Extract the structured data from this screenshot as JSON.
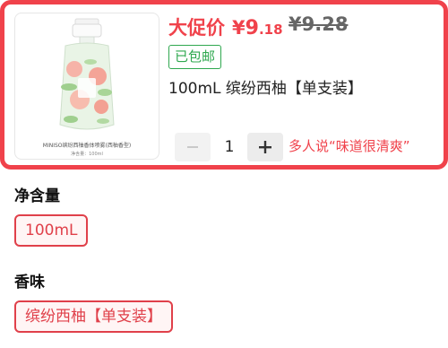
{
  "product": {
    "price_tag": "大促价",
    "currency": "¥",
    "price_int": "9",
    "price_dec": ".18",
    "original_price": "¥9.28",
    "shipping_badge": "已包邮",
    "variant": "100mL 缤纷西柚【单支装】",
    "image_caption": "MINISO缤纷西柚香体喷雾(西柚香型)",
    "image_net_content": "净含量：100ml"
  },
  "quantity": {
    "value": "1",
    "minus_icon": "minus-icon",
    "plus_icon": "plus-icon"
  },
  "promo_text": "多人说“味道很清爽”",
  "options": {
    "volume": {
      "title": "净含量",
      "selected": "100mL"
    },
    "scent": {
      "title": "香味",
      "selected": "缤纷西柚【单支装】"
    }
  },
  "colors": {
    "accent": "#f0424b",
    "shipping_green": "#2fa84f",
    "option_border": "#e0404a"
  }
}
